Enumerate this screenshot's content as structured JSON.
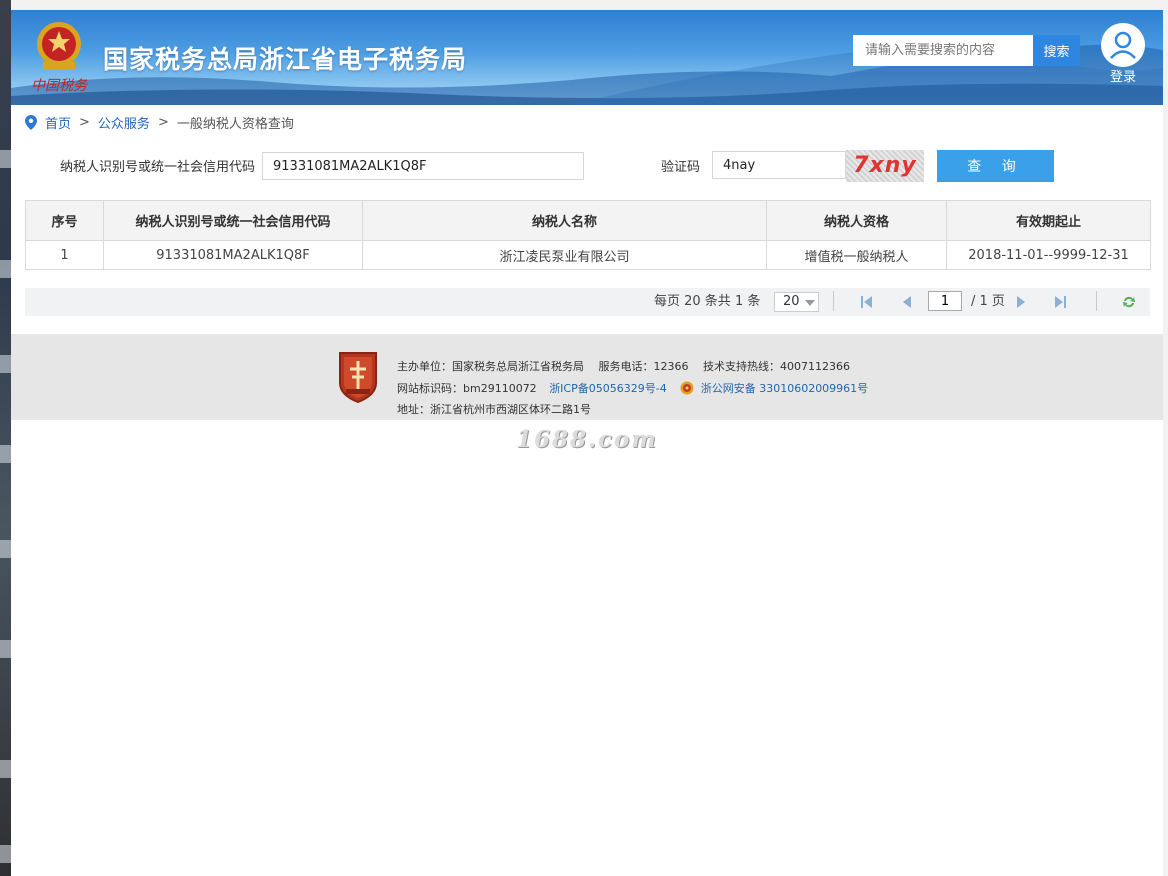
{
  "header": {
    "site_title": "国家税务总局浙江省电子税务局",
    "search_placeholder": "请输入需要搜索的内容",
    "search_button": "搜索",
    "login_label": "登录"
  },
  "breadcrumb": {
    "home": "首页",
    "sep": ">",
    "public_service": "公众服务",
    "current": "一般纳税人资格查询"
  },
  "query": {
    "taxpayer_id_label": "纳税人识别号或统一社会信用代码",
    "taxpayer_id_value": "91331081MA2ALK1Q8F",
    "captcha_label": "验证码",
    "captcha_value": "4nay",
    "captcha_image_text": "7xny",
    "query_button": "查 询"
  },
  "table": {
    "headers": [
      "序号",
      "纳税人识别号或统一社会信用代码",
      "纳税人名称",
      "纳税人资格",
      "有效期起止"
    ],
    "rows": [
      [
        "1",
        "91331081MA2ALK1Q8F",
        "浙江凌民泵业有限公司",
        "增值税一般纳税人",
        "2018-11-01--9999-12-31"
      ]
    ]
  },
  "pagination": {
    "summary": "每页 20 条共 1 条",
    "page_size": "20",
    "current_page": "1",
    "total_pages": "/ 1 页"
  },
  "footer": {
    "line1": "主办单位：国家税务总局浙江省税务局　 服务电话：12366　 技术支持热线：4007112366",
    "site_id": "网站标识码：bm29110072",
    "icp": "浙ICP备05056329号-4",
    "police": "浙公网安备 33010602009961号",
    "address": "地址：浙江省杭州市西湖区体环二路1号"
  },
  "watermark": "1688.com",
  "colors": {
    "header_blue": "#2f7fd0",
    "button_blue": "#3aa0ea",
    "link_blue": "#2266bb",
    "captcha_red": "#e03333"
  }
}
